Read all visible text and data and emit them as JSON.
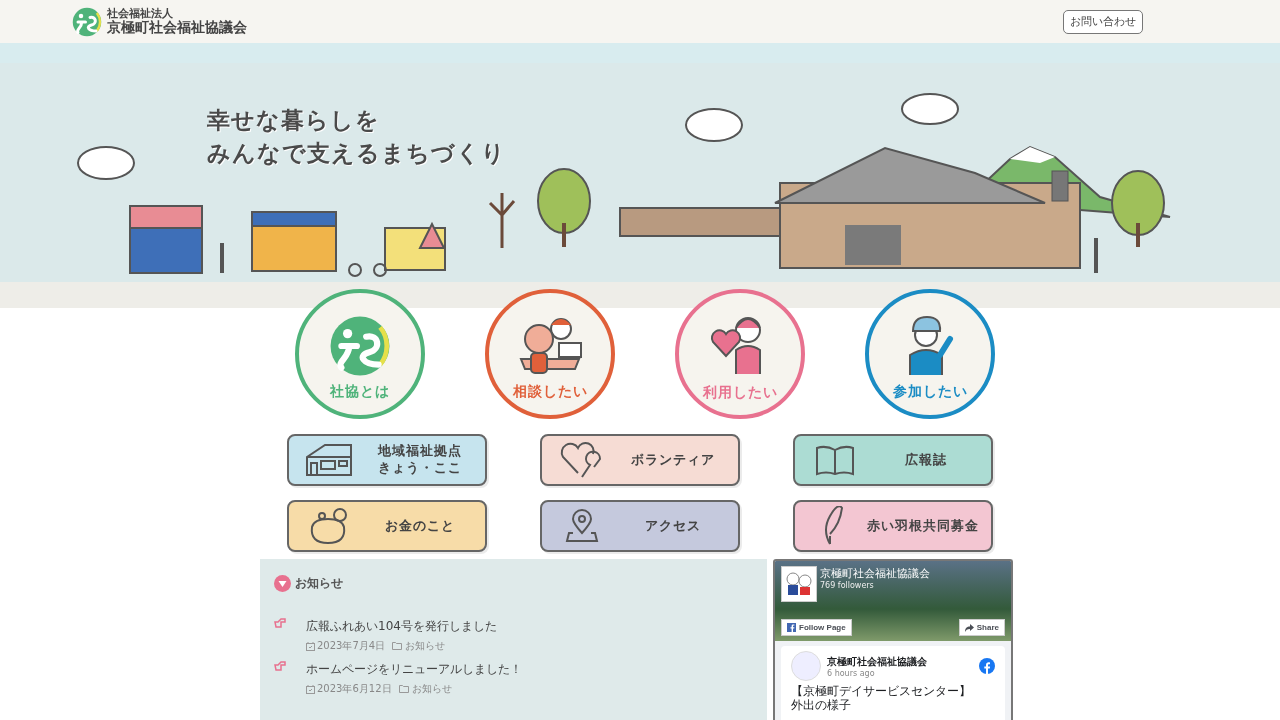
{
  "header": {
    "org_type": "社会福祉法人",
    "org_name": "京極町社会福祉協議会",
    "contact_button": "お問い合わせ"
  },
  "hero": {
    "tagline": [
      "幸せな暮らしを",
      "みんなで支えるまちづくり"
    ]
  },
  "circle_menu": [
    {
      "label": "社協とは",
      "color": "#4fb37a"
    },
    {
      "label": "相談したい",
      "color": "#e0603a"
    },
    {
      "label": "利用したい",
      "color": "#e8718f"
    },
    {
      "label": "参加したい",
      "color": "#1b8cc4"
    }
  ],
  "button_menu": [
    {
      "label": [
        "地域福祉拠点",
        "きょう・ここ"
      ],
      "color": "#c6e4ee"
    },
    {
      "label": [
        "ボランティア"
      ],
      "color": "#f6dcd4"
    },
    {
      "label": [
        "広報誌"
      ],
      "color": "#acdcd3"
    },
    {
      "label": [
        "お金のこと"
      ],
      "color": "#f7dca8"
    },
    {
      "label": [
        "アクセス"
      ],
      "color": "#c5c9dd"
    },
    {
      "label": [
        "赤い羽根共同募金"
      ],
      "color": "#f3c6d2"
    }
  ],
  "news": {
    "heading": "お知らせ",
    "items": [
      {
        "title": "広報ふれあい104号を発行しました",
        "date": "2023年7月4日",
        "category": "お知らせ"
      },
      {
        "title": "ホームページをリニューアルしました！",
        "date": "2023年6月12日",
        "category": "お知らせ"
      }
    ]
  },
  "facebook": {
    "page_name": "京極町社会福祉協議会",
    "followers": "769 followers",
    "follow_button": "Follow Page",
    "share_button": "Share",
    "post": {
      "author": "京極町社会福祉協議会",
      "time": "6 hours ago",
      "text": [
        "【京極町デイサービスセンター】",
        "外出の様子"
      ]
    }
  }
}
